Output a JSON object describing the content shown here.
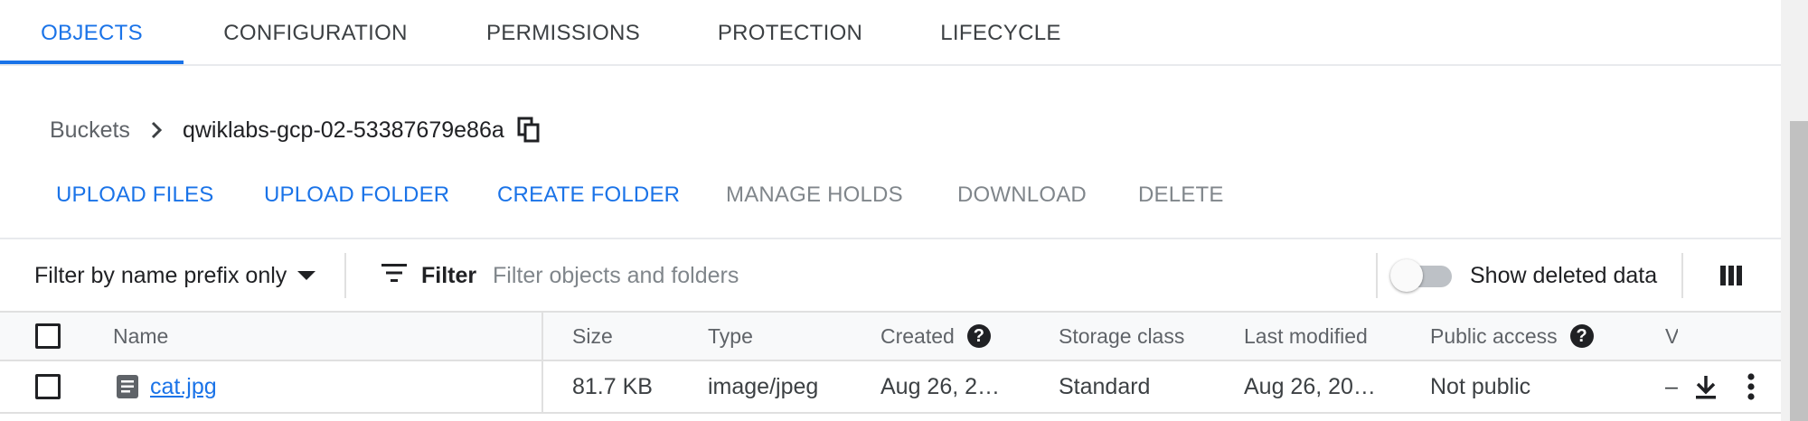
{
  "tabs": [
    {
      "label": "OBJECTS",
      "active": true
    },
    {
      "label": "CONFIGURATION",
      "active": false
    },
    {
      "label": "PERMISSIONS",
      "active": false
    },
    {
      "label": "PROTECTION",
      "active": false
    },
    {
      "label": "LIFECYCLE",
      "active": false
    }
  ],
  "breadcrumb": {
    "root": "Buckets",
    "current": "qwiklabs-gcp-02-53387679e86a"
  },
  "actions": {
    "upload_files": "UPLOAD FILES",
    "upload_folder": "UPLOAD FOLDER",
    "create_folder": "CREATE FOLDER",
    "manage_holds": "MANAGE HOLDS",
    "download": "DOWNLOAD",
    "delete": "DELETE"
  },
  "filter": {
    "prefix_mode": "Filter by name prefix only",
    "button_label": "Filter",
    "placeholder": "Filter objects and folders",
    "show_deleted_label": "Show deleted data",
    "show_deleted_on": false
  },
  "table": {
    "columns": {
      "name": "Name",
      "size": "Size",
      "type": "Type",
      "created": "Created",
      "storage_class": "Storage class",
      "last_modified": "Last modified",
      "public_access": "Public access",
      "versions": "V"
    },
    "rows": [
      {
        "name": "cat.jpg",
        "size": "81.7 KB",
        "type": "image/jpeg",
        "created": "Aug 26, 2…",
        "storage_class": "Standard",
        "last_modified": "Aug 26, 20…",
        "public_access": "Not public",
        "versions": "–"
      }
    ]
  },
  "colors": {
    "accent": "#1a73e8",
    "text": "#202124",
    "muted": "#5f6368",
    "disabled": "#80868b"
  }
}
